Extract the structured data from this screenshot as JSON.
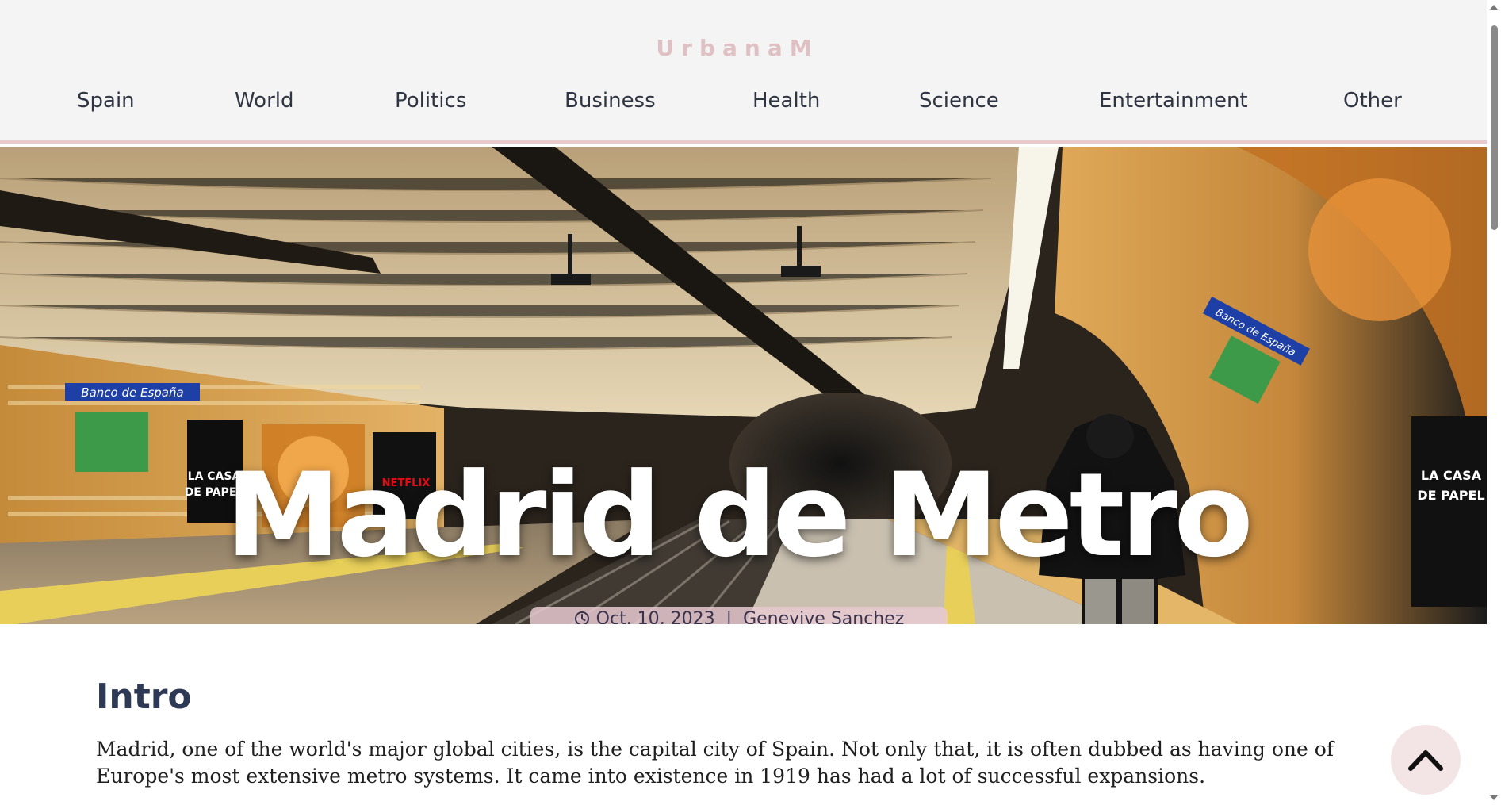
{
  "site": {
    "logo": "UrbanaM"
  },
  "nav": {
    "items": [
      {
        "label": "Spain"
      },
      {
        "label": "World"
      },
      {
        "label": "Politics"
      },
      {
        "label": "Business"
      },
      {
        "label": "Health"
      },
      {
        "label": "Science"
      },
      {
        "label": "Entertainment"
      },
      {
        "label": "Other"
      }
    ]
  },
  "hero": {
    "title": "Madrid de Metro",
    "date": "Oct. 10, 2023",
    "separator": "|",
    "author": "Genevive Sanchez",
    "image_signs": {
      "station_left": "Banco de España",
      "station_right": "Banco de España",
      "ad_text": "LA CASA DE PAPEL",
      "brand": "NETFLIX"
    }
  },
  "article": {
    "section_title": "Intro",
    "body": "Madrid, one of the world's major global cities, is the capital city of Spain. Not only that, it is often dubbed as having one of Europe's most extensive metro systems. It came into existence in 1919 has had a lot of successful expansions."
  },
  "colors": {
    "header_bg": "#f4f4f4",
    "accent_pink": "#e8c9cc",
    "nav_text": "#2f3542",
    "heading": "#2e3a55"
  },
  "icons": {
    "clock": "clock-icon",
    "back_to_top": "chevron-up-icon"
  }
}
